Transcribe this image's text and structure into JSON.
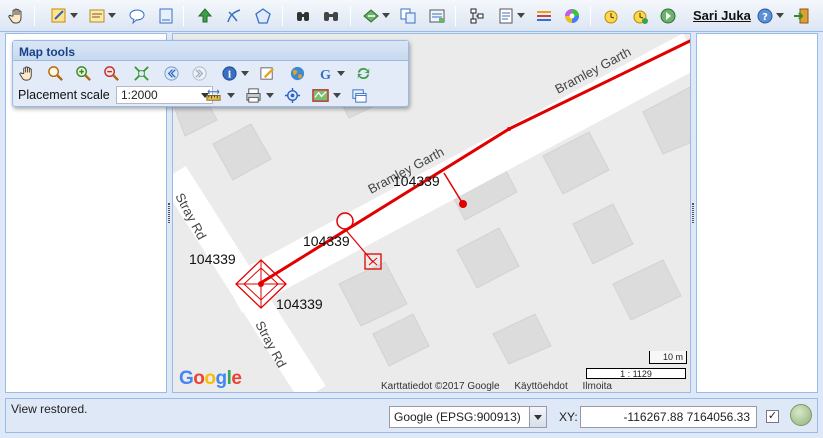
{
  "toolbar": {
    "icons": [
      "hand-icon",
      "edit-layer-icon",
      "form-icon",
      "comment-icon",
      "document-icon",
      "move-icon",
      "split-line-icon",
      "polygon-icon",
      "search-icon",
      "find-icon",
      "route-icon",
      "copy-icon",
      "report-icon",
      "network-icon",
      "list-icon",
      "layers-icon",
      "color-wheel-icon",
      "alarm-icon",
      "alarm-add-icon",
      "forward-icon",
      "help-icon",
      "logout-icon"
    ],
    "user_name": "Sari Juka"
  },
  "map_tools": {
    "title": "Map tools",
    "placement_label": "Placement scale",
    "placement_value": "1:2000"
  },
  "map": {
    "roads": [
      {
        "name": "Bramley Garth"
      },
      {
        "name": "Bramley Garth"
      },
      {
        "name": "Stray Rd"
      },
      {
        "name": "Stray Rd"
      }
    ],
    "labels": [
      {
        "text": "104339"
      },
      {
        "text": "104339"
      },
      {
        "text": "104339"
      },
      {
        "text": "104339"
      }
    ],
    "logo": "Google",
    "footer": {
      "attribution": "Karttatiedot ©2017 Google",
      "terms": "Käyttöehdot",
      "report": "Ilmoita karttavirheestä"
    },
    "scale_bar": "10 m",
    "scale_ratio": "1 : 1129"
  },
  "status_bar": {
    "message": "View restored.",
    "projection": "Google (EPSG:900913)",
    "xy_label": "XY:",
    "xy_value": "-116267.88 7164056.33",
    "check_mark": "✓"
  },
  "colors": {
    "accent": "#15428b",
    "feature_red": "#e10000",
    "map_bg": "#ebebeb",
    "building": "#dcdcdc"
  }
}
